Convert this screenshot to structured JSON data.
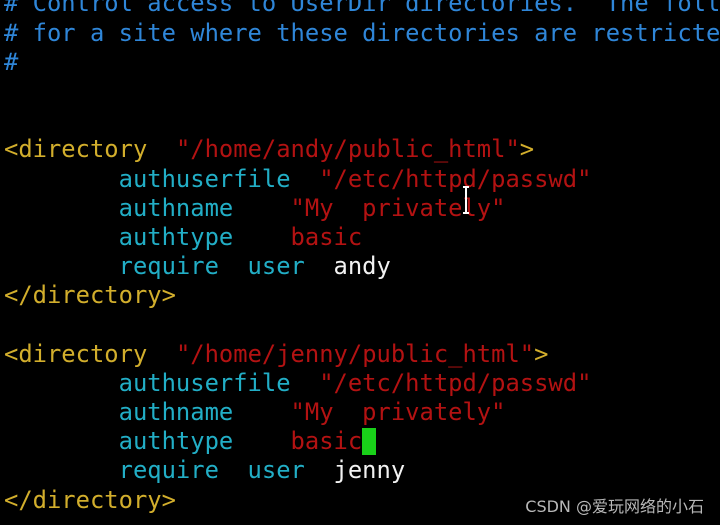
{
  "editor": {
    "lines": [
      [
        {
          "t": "# Control access to UserDir directories.  The follo",
          "c": "comment"
        }
      ],
      [
        {
          "t": "# for a site where these directories are restricted",
          "c": "comment"
        }
      ],
      [
        {
          "t": "#",
          "c": "comment"
        }
      ],
      [],
      [],
      [
        {
          "t": "<directory  ",
          "c": "tag"
        },
        {
          "t": "\"/home/andy/public_html\"",
          "c": "string"
        },
        {
          "t": ">",
          "c": "tag"
        }
      ],
      [
        {
          "t": "        authuserfile  ",
          "c": "keyword"
        },
        {
          "t": "\"/etc/httpd/passwd\"",
          "c": "string"
        }
      ],
      [
        {
          "t": "        authname    ",
          "c": "keyword"
        },
        {
          "t": "\"My  privately\"",
          "c": "string"
        }
      ],
      [
        {
          "t": "        authtype    ",
          "c": "keyword"
        },
        {
          "t": "basic",
          "c": "string"
        }
      ],
      [
        {
          "t": "        require  user  ",
          "c": "keyword"
        },
        {
          "t": "andy",
          "c": "plain"
        }
      ],
      [
        {
          "t": "</directory>",
          "c": "tag"
        }
      ],
      [],
      [
        {
          "t": "<directory  ",
          "c": "tag"
        },
        {
          "t": "\"/home/jenny/public_html\"",
          "c": "string"
        },
        {
          "t": ">",
          "c": "tag"
        }
      ],
      [
        {
          "t": "        authuserfile  ",
          "c": "keyword"
        },
        {
          "t": "\"/etc/httpd/passwd\"",
          "c": "string"
        }
      ],
      [
        {
          "t": "        authname    ",
          "c": "keyword"
        },
        {
          "t": "\"My  privately\"",
          "c": "string"
        }
      ],
      [
        {
          "t": "        authtype    ",
          "c": "keyword"
        },
        {
          "t": "basic",
          "c": "string"
        },
        {
          "cursor": true
        }
      ],
      [
        {
          "t": "        require  user  ",
          "c": "keyword"
        },
        {
          "t": "jenny",
          "c": "plain"
        }
      ],
      [
        {
          "t": "</directory>",
          "c": "tag"
        }
      ]
    ]
  },
  "colors": {
    "comment": "#2f86d8",
    "tag": "#d2ae2c",
    "string": "#b31212",
    "keyword": "#22aec6",
    "cursor": "#19d019"
  },
  "mouse_pointer": "i-beam-icon",
  "watermark": "CSDN @爱玩网络的小石"
}
